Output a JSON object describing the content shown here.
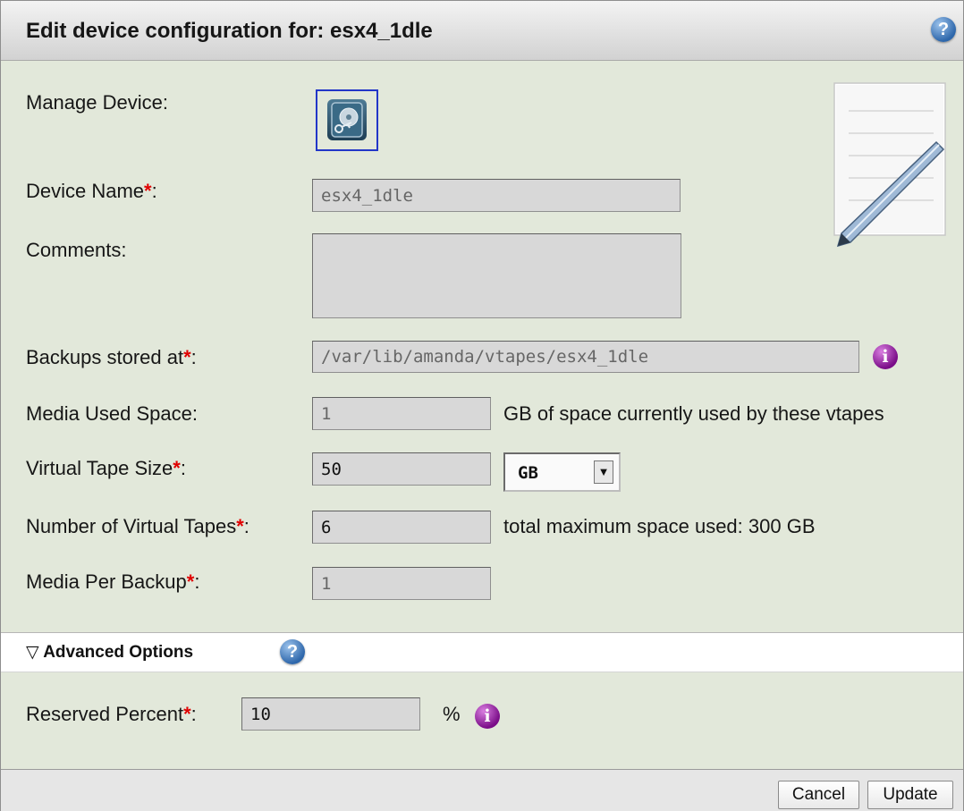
{
  "dialog": {
    "title": "Edit device configuration for: esx4_1dle",
    "help_symbol": "?"
  },
  "icons": {
    "device": "hard-disk-key-icon",
    "notepad": "notepad-pencil-icon",
    "help": "question-circle-icon",
    "info": "info-circle-icon"
  },
  "colors": {
    "panel_bg": "#e2e8da",
    "required_marker": "#e00000",
    "info_icon": "#8b1a96",
    "help_icon": "#2e67ab",
    "selection_border": "#2236c8"
  },
  "form": {
    "required_mark": "*",
    "manage_device": {
      "label": "Manage Device:"
    },
    "device_name": {
      "label": "Device Name",
      "suffix": ":",
      "value": "esx4_1dle"
    },
    "comments": {
      "label": "Comments:",
      "value": ""
    },
    "backups_stored_at": {
      "label": "Backups stored at",
      "suffix": ":",
      "value": "/var/lib/amanda/vtapes/esx4_1dle",
      "info_symbol": "i"
    },
    "media_used_space": {
      "label": "Media Used Space:",
      "value": "1",
      "note": "GB of space currently used by these vtapes"
    },
    "virtual_tape_size": {
      "label": "Virtual Tape Size",
      "suffix": ":",
      "value": "50",
      "unit_selected": "GB",
      "unit_arrow": "▼"
    },
    "number_of_virtual_tapes": {
      "label": "Number of Virtual Tapes",
      "suffix": ":",
      "value": "6",
      "note": "total maximum space used: 300 GB"
    },
    "media_per_backup": {
      "label": "Media Per Backup",
      "suffix": ":",
      "value": "1"
    }
  },
  "advanced": {
    "toggle_symbol": "▽",
    "label": "Advanced Options",
    "help_symbol": "?",
    "reserved_percent": {
      "label": "Reserved Percent",
      "suffix": ":",
      "value": "10",
      "unit": "%",
      "info_symbol": "i"
    }
  },
  "footer": {
    "cancel_label": "Cancel",
    "update_label": "Update"
  }
}
